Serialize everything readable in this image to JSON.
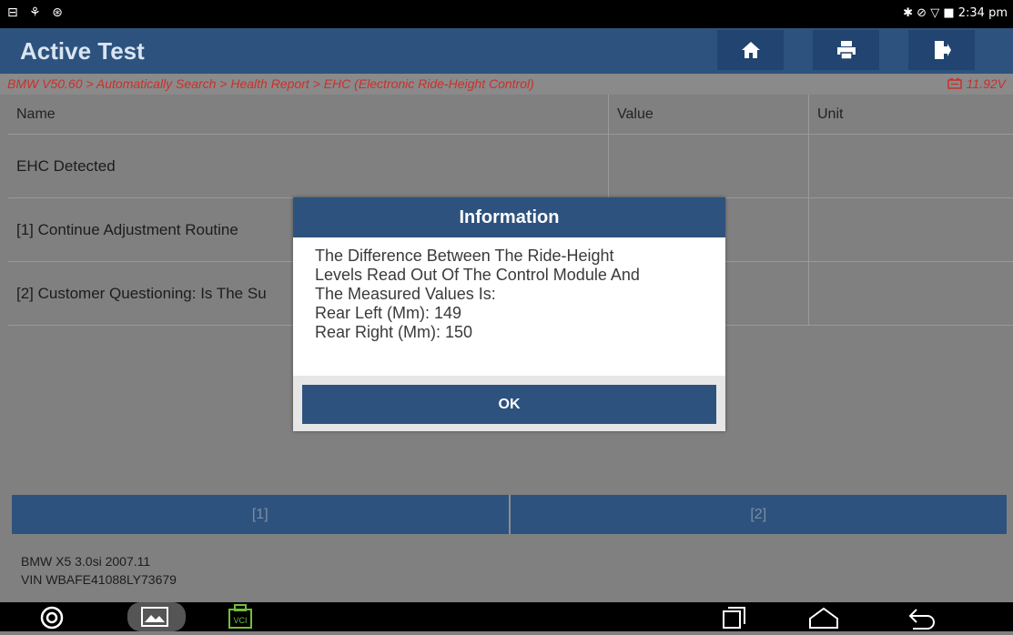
{
  "status_bar": {
    "left_icons": "⊟ ⚘ ⊛",
    "right_text": "✱ ⊘ ▽ ■ 2:34 pm"
  },
  "header": {
    "title": "Active Test",
    "home_icon": "home-icon",
    "print_icon": "printer-icon",
    "exit_icon": "exit-icon"
  },
  "breadcrumb": "BMW V50.60 > Automatically Search > Health Report > EHC (Electronic Ride-Height Control)",
  "voltage": "11.92V",
  "table": {
    "headers": [
      "Name",
      "Value",
      "Unit"
    ],
    "rows": [
      {
        "name": "EHC Detected",
        "value": "",
        "unit": ""
      },
      {
        "name": "[1] Continue Adjustment Routine",
        "value": "",
        "unit": ""
      },
      {
        "name": "[2] Customer Questioning: Is The Su",
        "value": "",
        "unit": ""
      }
    ]
  },
  "dialog": {
    "title": "Information",
    "message_lines": [
      "The Difference Between The Ride-Height",
      "Levels Read Out Of The Control Module And",
      "The Measured Values Is:",
      "Rear Left (Mm): 149",
      "Rear Right (Mm): 150"
    ],
    "ok_label": "OK"
  },
  "tabs": [
    "[1]",
    "[2]"
  ],
  "vehicle": {
    "model": "BMW X5 3.0si 2007.11",
    "vin": "VIN WBAFE41088LY73679"
  },
  "nav_bar": {
    "vci_label": "VCI"
  }
}
